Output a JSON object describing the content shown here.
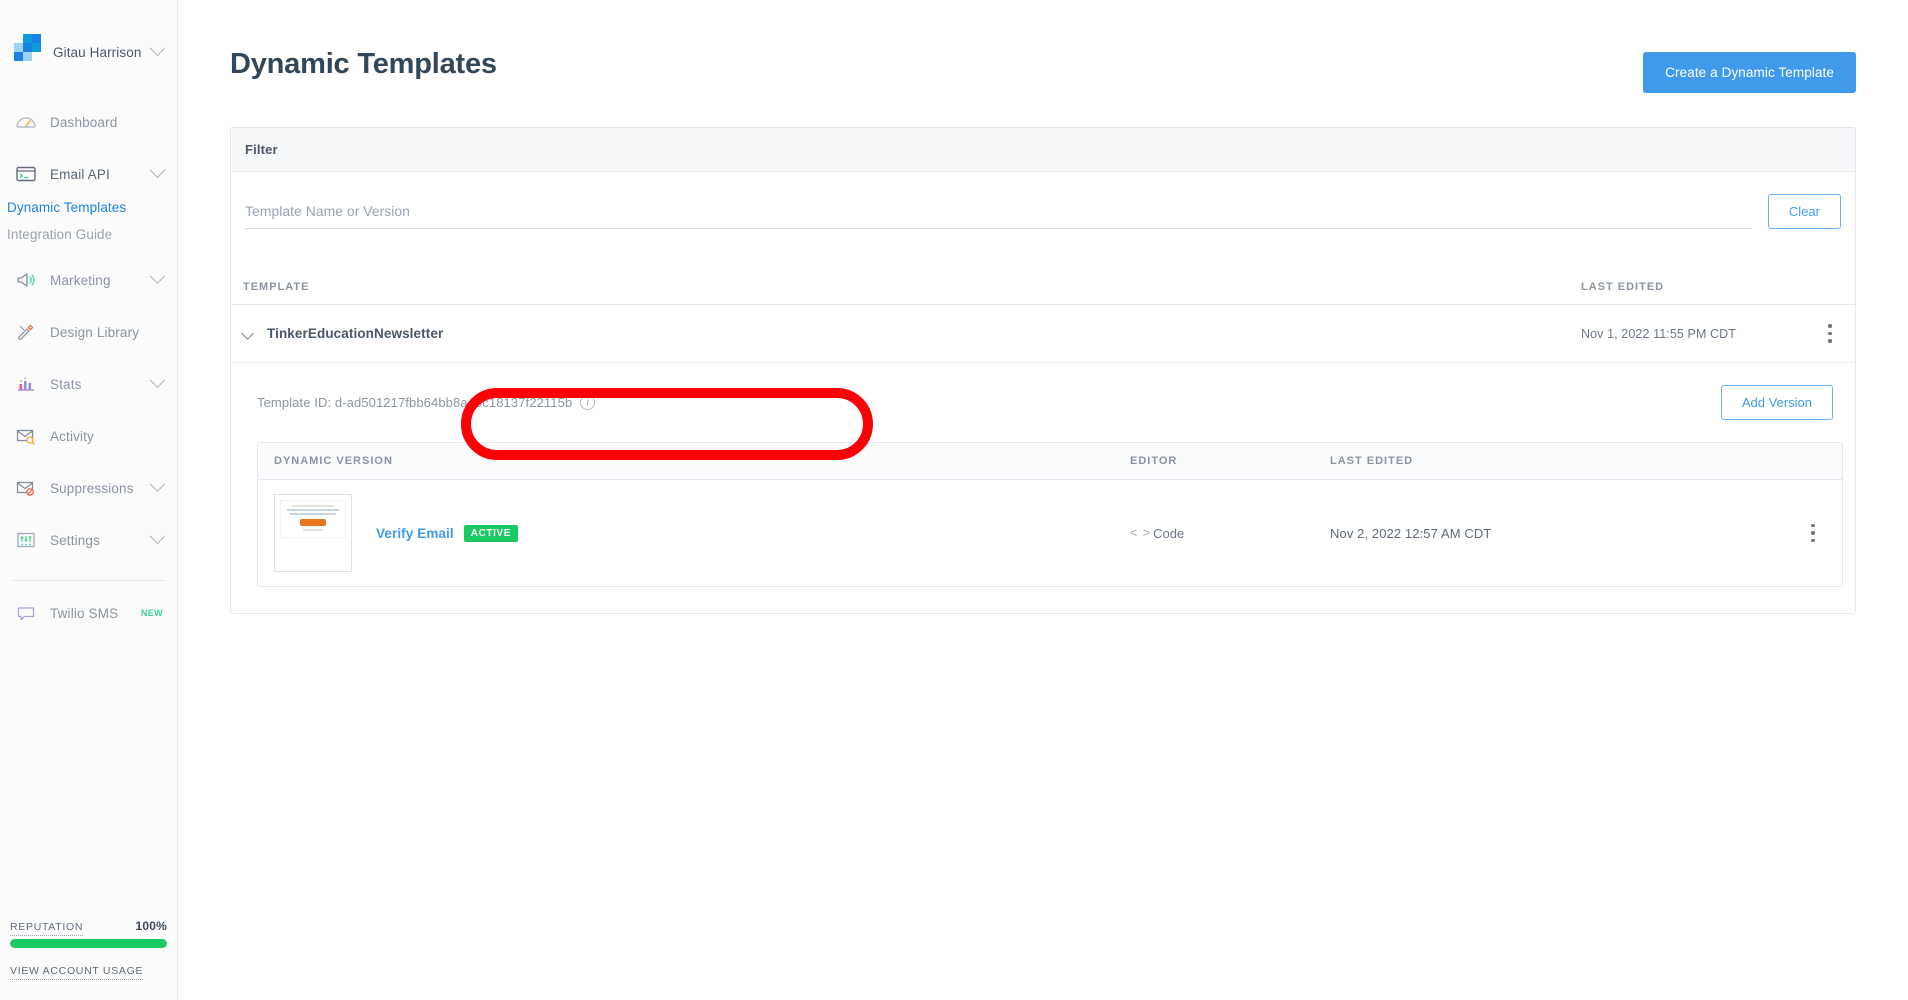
{
  "sidebar": {
    "account": {
      "name": "Gitau Harrison",
      "chevron_icon": "chevron-down-icon"
    },
    "items": [
      {
        "label": "Dashboard",
        "icon": "dashboard-gauge-icon",
        "expandable": false
      },
      {
        "label": "Email API",
        "icon": "terminal-window-icon",
        "expandable": true
      },
      {
        "label": "Marketing",
        "icon": "megaphone-icon",
        "expandable": true
      },
      {
        "label": "Design Library",
        "icon": "pencil-ruler-icon",
        "expandable": false
      },
      {
        "label": "Stats",
        "icon": "bar-chart-icon",
        "expandable": true
      },
      {
        "label": "Activity",
        "icon": "envelope-search-icon",
        "expandable": false
      },
      {
        "label": "Suppressions",
        "icon": "envelope-block-icon",
        "expandable": true
      },
      {
        "label": "Settings",
        "icon": "sliders-icon",
        "expandable": true
      }
    ],
    "email_api_children": [
      {
        "label": "Dynamic Templates",
        "active": true
      },
      {
        "label": "Integration Guide",
        "active": false
      }
    ],
    "twilio": {
      "label": "Twilio SMS",
      "badge": "NEW",
      "icon": "chat-bubble-icon"
    },
    "reputation": {
      "label": "REPUTATION",
      "value": "100%",
      "percent": 100,
      "color": "#18c964"
    },
    "account_usage_link": "VIEW ACCOUNT USAGE"
  },
  "header": {
    "title": "Dynamic Templates",
    "create_button": "Create a Dynamic Template"
  },
  "filter": {
    "title": "Filter",
    "input_value": "",
    "placeholder": "Template Name or Version",
    "clear_button": "Clear"
  },
  "table": {
    "columns": {
      "template": "TEMPLATE",
      "last_edited": "LAST EDITED"
    },
    "rows": [
      {
        "name": "TinkerEducationNewsletter",
        "last_edited": "Nov 1, 2022 11:55 PM CDT",
        "expanded": true,
        "template_id_label": "Template ID: d-ad501217fbb64bb8a40c18137f22115b",
        "info_icon": "info-icon",
        "add_version_button": "Add Version",
        "version_columns": {
          "version": "DYNAMIC VERSION",
          "editor": "EDITOR",
          "last_edited": "LAST EDITED"
        },
        "versions": [
          {
            "name": "Verify Email",
            "status": "ACTIVE",
            "status_color": "#18c964",
            "editor": "Code",
            "editor_icon": "code-brackets-icon",
            "last_edited": "Nov 2, 2022 12:57 AM CDT",
            "menu_icon": "kebab-menu-icon"
          }
        ],
        "menu_icon": "kebab-menu-icon"
      }
    ]
  },
  "annotation": {
    "shape": "red-oval-highlight",
    "color": "#fb0007"
  }
}
